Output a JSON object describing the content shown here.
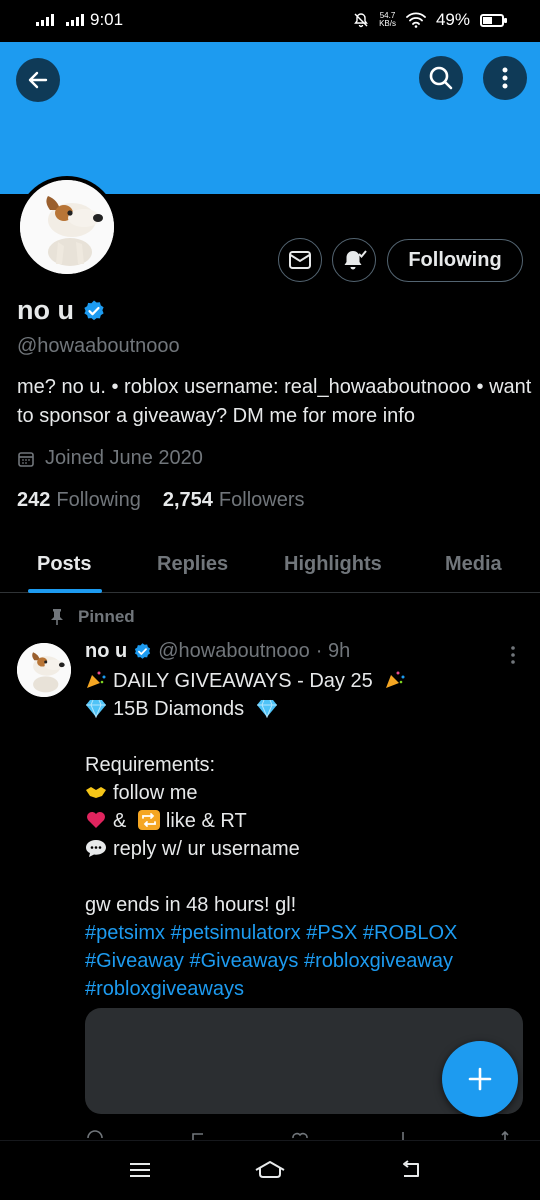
{
  "status_bar": {
    "time": "9:01",
    "net_speed_value": "54.7",
    "net_speed_unit": "KB/s",
    "battery": "49%",
    "battery_level": 0.49
  },
  "profile": {
    "name": "no u",
    "handle": "@howaaboutnooo",
    "bio": "me? no u. • roblox username: real_howaaboutnooo • want to sponsor a giveaway? DM me for more info",
    "joined": "Joined June 2020",
    "following_count": "242",
    "following_label": "Following",
    "followers_count": "2,754",
    "followers_label": "Followers",
    "follow_button": "Following"
  },
  "tabs": [
    {
      "label": "Posts",
      "active": true
    },
    {
      "label": "Replies",
      "active": false
    },
    {
      "label": "Highlights",
      "active": false
    },
    {
      "label": "Media",
      "active": false
    }
  ],
  "pinned_post": {
    "pinned_label": "Pinned",
    "author": "no u",
    "handle": "@howaboutnooo",
    "time": "· 9h",
    "lines": {
      "title": "DAILY GIVEAWAYS - Day 25",
      "prize": "15B Diamonds",
      "requirements": "Requirements:",
      "req1": "follow me",
      "req2_amp": "&",
      "req2_text": "like & RT",
      "req3": "reply w/ ur username",
      "ends": "gw ends in 48 hours! gl!",
      "tags1": "#petsimx #petsimulatorx #PSX #ROBLOX",
      "tags2": "#Giveaway #Giveaways #robloxgiveaway",
      "tags3": "#robloxgiveaways"
    }
  },
  "colors": {
    "accent": "#1d9bf0",
    "background": "#000000",
    "text": "#e7e9ea",
    "muted": "#71767b"
  },
  "icons": [
    "back-arrow-icon",
    "search-icon",
    "more-vertical-icon",
    "mail-icon",
    "bell-icon",
    "verified-badge-icon",
    "calendar-icon",
    "pin-icon",
    "plus-icon",
    "menu-icon",
    "home-icon",
    "back-icon"
  ]
}
